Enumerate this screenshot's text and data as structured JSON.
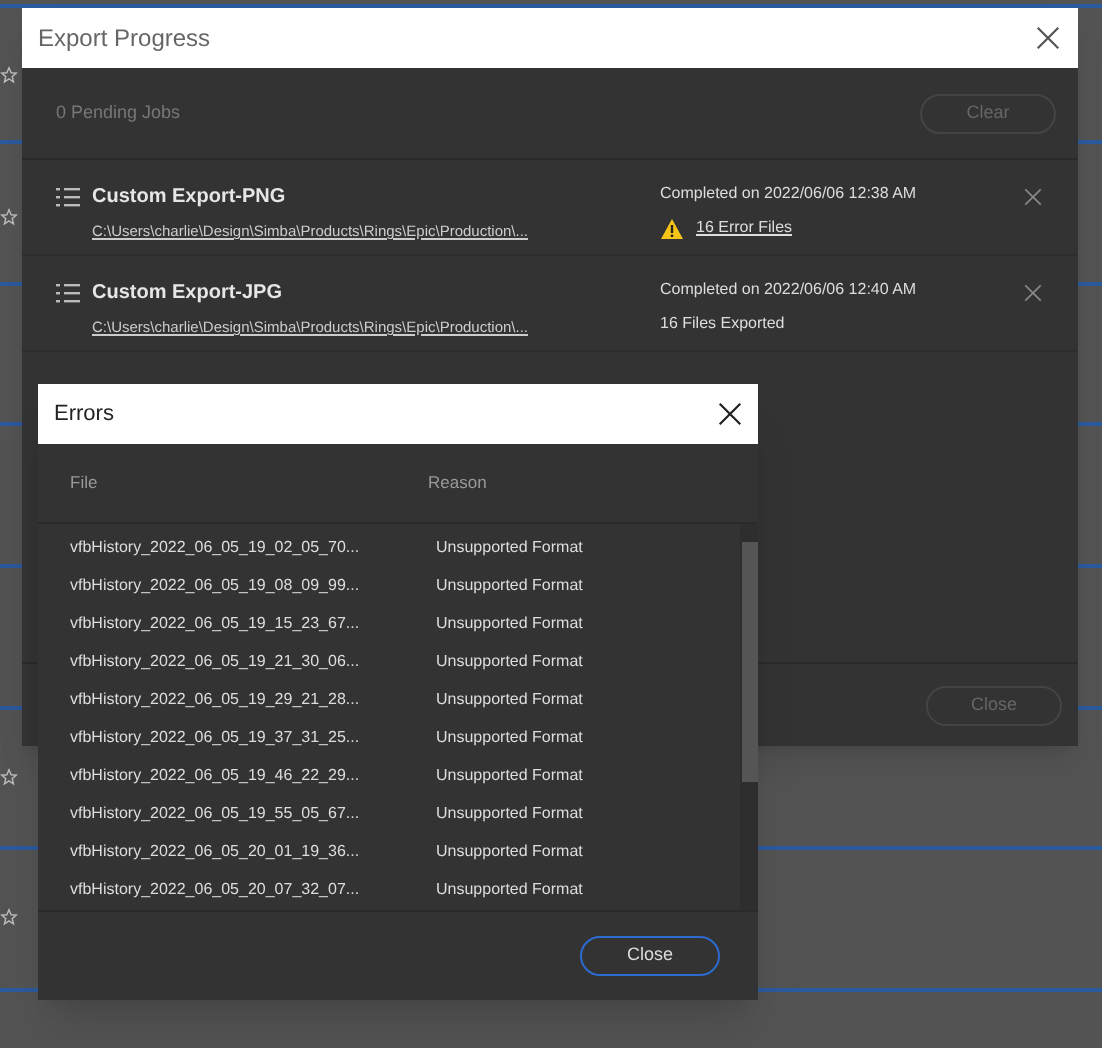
{
  "export_window": {
    "title": "Export Progress",
    "pending_jobs": "0 Pending Jobs",
    "clear_button": {
      "label": "Clear",
      "disabled": true
    },
    "jobs": [
      {
        "name": "Custom Export-PNG",
        "path": "C:\\Users\\charlie\\Design\\Simba\\Products\\Rings\\Epic\\Production\\...",
        "status": "Completed on 2022/06/06 12:38 AM",
        "kind": "error",
        "result": "16 Error Files"
      },
      {
        "name": "Custom Export-JPG",
        "path": "C:\\Users\\charlie\\Design\\Simba\\Products\\Rings\\Epic\\Production\\...",
        "status": "Completed on 2022/06/06 12:40 AM",
        "kind": "success",
        "result": "16 Files Exported"
      }
    ],
    "close_button": {
      "label": "Close",
      "disabled": true
    }
  },
  "errors_window": {
    "title": "Errors",
    "columns": [
      "File",
      "Reason"
    ],
    "rows": [
      {
        "file": "vfbHistory_2022_06_05_19_02_05_70...",
        "reason": "Unsupported Format"
      },
      {
        "file": "vfbHistory_2022_06_05_19_08_09_99...",
        "reason": "Unsupported Format"
      },
      {
        "file": "vfbHistory_2022_06_05_19_15_23_67...",
        "reason": "Unsupported Format"
      },
      {
        "file": "vfbHistory_2022_06_05_19_21_30_06...",
        "reason": "Unsupported Format"
      },
      {
        "file": "vfbHistory_2022_06_05_19_29_21_28...",
        "reason": "Unsupported Format"
      },
      {
        "file": "vfbHistory_2022_06_05_19_37_31_25...",
        "reason": "Unsupported Format"
      },
      {
        "file": "vfbHistory_2022_06_05_19_46_22_29...",
        "reason": "Unsupported Format"
      },
      {
        "file": "vfbHistory_2022_06_05_19_55_05_67...",
        "reason": "Unsupported Format"
      },
      {
        "file": "vfbHistory_2022_06_05_20_01_19_36...",
        "reason": "Unsupported Format"
      },
      {
        "file": "vfbHistory_2022_06_05_20_07_32_07...",
        "reason": "Unsupported Format"
      }
    ],
    "close_button": {
      "label": "Close"
    }
  }
}
